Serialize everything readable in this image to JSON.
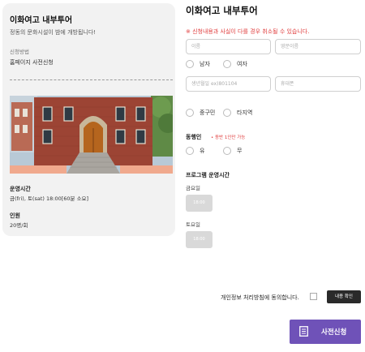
{
  "info": {
    "title": "이화여고 내부투어",
    "description": "정동의 문화시설이 밤에 개방됩니다!",
    "apply_label": "신청방법",
    "apply_value": "홈페이지 사전신청",
    "hours_label": "운영시간",
    "hours_value": "금(fri), 토(sat) 18:00[60분 소요]",
    "capacity_label": "인원",
    "capacity_value": "20명/회"
  },
  "form": {
    "title": "이화여고 내부투어",
    "warning": "※ 신청내용과 사실이 다를 경우 취소될 수 있습니다.",
    "name_placeholder": "이름",
    "english_name_placeholder": "영문이름",
    "gender_options": [
      "남자",
      "여자"
    ],
    "birth_placeholder": "생년월일 ex)801104",
    "phone_placeholder": "휴대폰",
    "region_options": [
      "중구민",
      "타지역"
    ],
    "companion_label": "동행인",
    "companion_note": "• 동반 1인만 가능",
    "companion_options": [
      "유",
      "무"
    ],
    "schedule_label": "프로그램 운영시간",
    "days": [
      {
        "label": "금요일",
        "slot": "18:00"
      },
      {
        "label": "토요일",
        "slot": "18:00"
      }
    ],
    "agree_text": "개인정보 처리방침에 동의합니다.",
    "confirm_label": "내용 확인",
    "submit_label": "사전신청"
  },
  "colors": {
    "accent": "#6f52b8",
    "warning": "#e03c3c",
    "card_bg": "#f2f2f2",
    "slot_disabled": "#d9d9d9"
  },
  "icons": {
    "submit": "document-icon"
  }
}
